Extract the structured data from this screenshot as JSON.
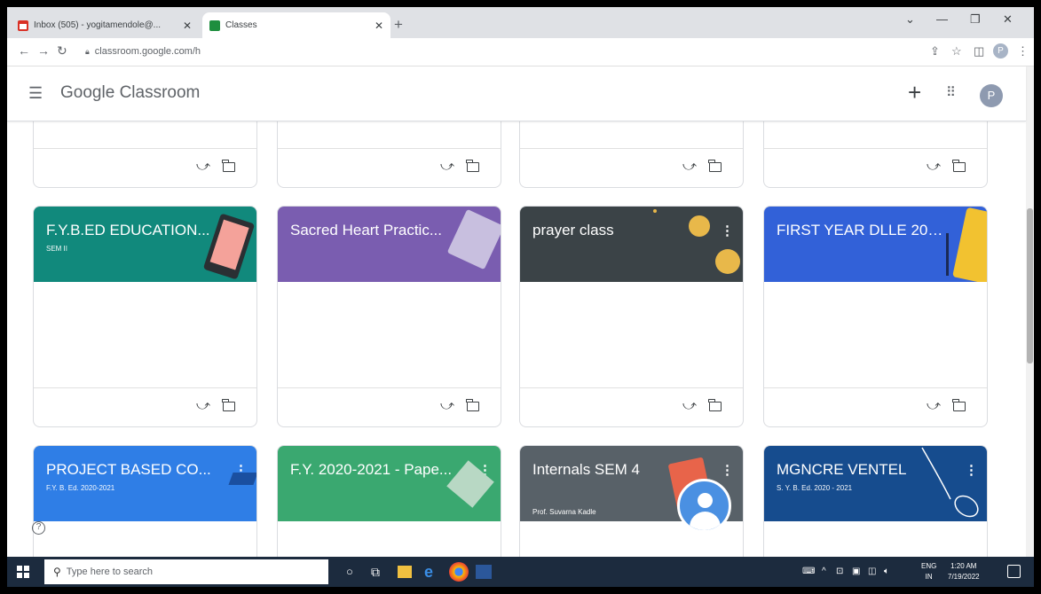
{
  "browser": {
    "tabs": [
      {
        "title": "Inbox (505) - yogitamendole@...",
        "favicon": "gmail-icon"
      },
      {
        "title": "Classes",
        "favicon": "classroom-icon"
      }
    ],
    "url": "classroom.google.com/h",
    "profile_letter": "P"
  },
  "header": {
    "brand_google": "Google",
    "brand_product": "Classroom",
    "avatar_letter": "P"
  },
  "top_cards": [
    {
      "id": "c1"
    },
    {
      "id": "c2"
    },
    {
      "id": "c3"
    },
    {
      "id": "c4"
    }
  ],
  "classes": [
    {
      "name": "F.Y.B.ED EDUCATION...",
      "section": "SEM II",
      "teacher": "",
      "color": "#11897c",
      "deco": "tablet"
    },
    {
      "name": "Sacred Heart Practic...",
      "section": "",
      "teacher": "",
      "color": "#7a5db0",
      "deco": "notebook"
    },
    {
      "name": "prayer class",
      "section": "",
      "teacher": "",
      "color": "#3b4347",
      "deco": "coins"
    },
    {
      "name": "FIRST YEAR DLLE 202...",
      "section": "",
      "teacher": "",
      "color": "#3261d8",
      "deco": "book"
    },
    {
      "name": "PROJECT BASED CO...",
      "section": "F.Y. B. Ed. 2020-2021",
      "teacher": "",
      "color": "#2f7ee6",
      "deco": "cap"
    },
    {
      "name": "F.Y. 2020-2021 - Pape...",
      "section": "",
      "teacher": "",
      "color": "#3aa870",
      "deco": "paper"
    },
    {
      "name": "Internals SEM 4",
      "section": "",
      "teacher": "Prof. Suvarna Kadle",
      "color": "#586168",
      "deco": "redbook"
    },
    {
      "name": "MGNCRE VENTEL",
      "section": "S. Y. B. Ed. 2020 - 2021",
      "teacher": "",
      "color": "#164c8e",
      "deco": "lines"
    }
  ],
  "taskbar": {
    "search_placeholder": "Type here to search",
    "lang_top": "ENG",
    "lang_bottom": "IN",
    "time": "1:20 AM",
    "date": "7/19/2022"
  }
}
